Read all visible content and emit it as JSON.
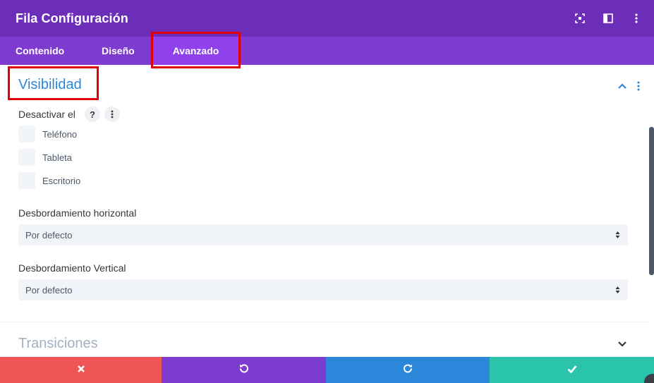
{
  "header": {
    "title": "Fila Configuración",
    "icons": [
      "fullscreen-icon",
      "sidebar-toggle-icon",
      "more-vertical-icon"
    ]
  },
  "tabs": [
    {
      "label": "Contenido",
      "active": false
    },
    {
      "label": "Diseño",
      "active": false
    },
    {
      "label": "Avanzado",
      "active": true
    }
  ],
  "visibility": {
    "title": "Visibilidad",
    "disable_label": "Desactivar el",
    "help_symbol": "?",
    "options": [
      "Teléfono",
      "Tableta",
      "Escritorio"
    ],
    "overflow_x": {
      "label": "Desbordamiento horizontal",
      "value": "Por defecto"
    },
    "overflow_y": {
      "label": "Desbordamiento Vertical",
      "value": "Por defecto"
    }
  },
  "transitions": {
    "title": "Transiciones"
  },
  "footer": {
    "buttons": [
      {
        "name": "discard",
        "icon": "close-icon",
        "color": "#ef5555"
      },
      {
        "name": "undo",
        "icon": "undo-icon",
        "color": "#7e3bd0"
      },
      {
        "name": "redo",
        "icon": "redo-icon",
        "color": "#2b87da"
      },
      {
        "name": "save",
        "icon": "check-icon",
        "color": "#29c4a9"
      }
    ]
  },
  "colors": {
    "header_bg": "#6c2eb9",
    "tabs_bg": "#7e3bd0",
    "active_tab_bg": "#8f42ec",
    "accent_blue": "#2b87da",
    "highlight_red": "#e0000b"
  }
}
